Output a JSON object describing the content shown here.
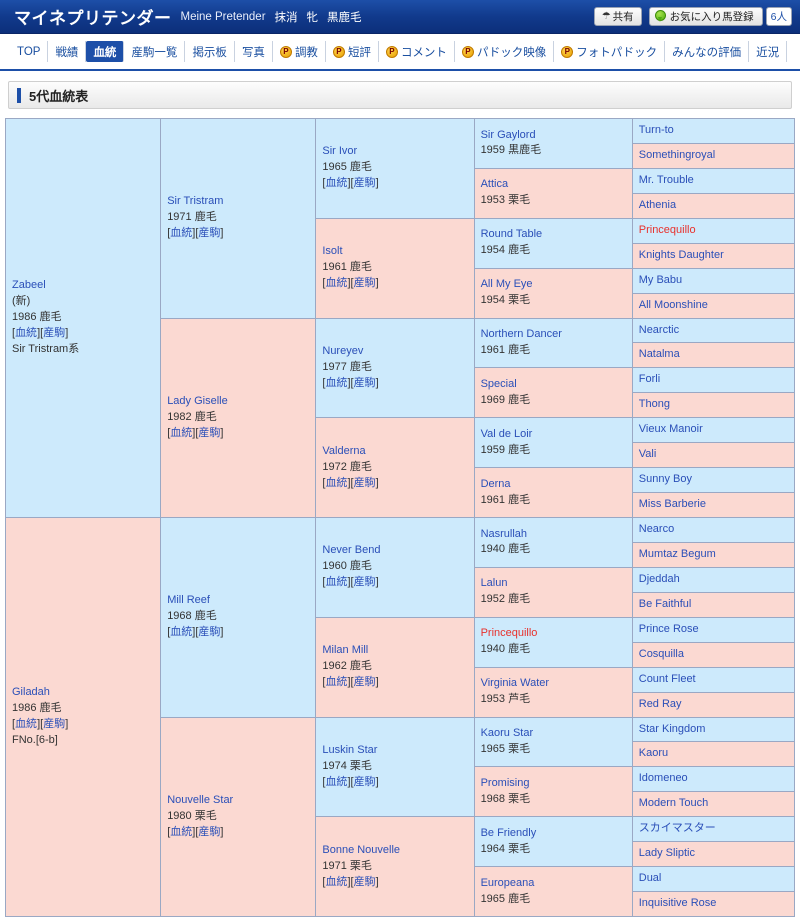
{
  "header": {
    "horse_name_ja": "マイネプリテンダー",
    "horse_name_en": "Meine Pretender",
    "status": "抹消",
    "sex": "牝",
    "color": "黒鹿毛",
    "share_label": "共有",
    "share_icon": "share-icon",
    "favorite_label": "お気に入り馬登録",
    "favorite_icon": "map-pin-icon",
    "favorite_count": "6人",
    "accent_color": "#1d4fa8"
  },
  "nav": {
    "items": [
      {
        "label": "TOP",
        "premium": false,
        "active": false
      },
      {
        "label": "戦績",
        "premium": false,
        "active": false
      },
      {
        "label": "血統",
        "premium": false,
        "active": true
      },
      {
        "label": "産駒一覧",
        "premium": false,
        "active": false
      },
      {
        "label": "掲示板",
        "premium": false,
        "active": false
      },
      {
        "label": "写真",
        "premium": false,
        "active": false
      },
      {
        "label": "調教",
        "premium": true,
        "active": false
      },
      {
        "label": "短評",
        "premium": true,
        "active": false
      },
      {
        "label": "コメント",
        "premium": true,
        "active": false
      },
      {
        "label": "パドック映像",
        "premium": true,
        "active": false
      },
      {
        "label": "フォトパドック",
        "premium": true,
        "active": false
      },
      {
        "label": "みんなの評価",
        "premium": false,
        "active": false
      },
      {
        "label": "近況",
        "premium": false,
        "active": false
      }
    ],
    "premium_badge": "P"
  },
  "section": {
    "title": "5代血統表"
  },
  "links": {
    "pedigree": "血統",
    "offspring": "産駒",
    "open": "[",
    "close": "]"
  },
  "pedigree": {
    "gen1": [
      {
        "name": "Zabeel",
        "country": "(新)",
        "detail": "1986 鹿毛",
        "line": "Sir Tristram系",
        "sex": "m",
        "links": true,
        "red": false
      },
      {
        "name": "Giladah",
        "country": "",
        "detail": "1986 鹿毛",
        "line": "FNo.[6-b]",
        "sex": "f",
        "links": true,
        "red": false
      }
    ],
    "gen2": [
      {
        "name": "Sir Tristram",
        "detail": "1971 鹿毛",
        "sex": "m",
        "links": true,
        "red": false
      },
      {
        "name": "Lady Giselle",
        "detail": "1982 鹿毛",
        "sex": "f",
        "links": true,
        "red": false
      },
      {
        "name": "Mill Reef",
        "detail": "1968 鹿毛",
        "sex": "m",
        "links": true,
        "red": false
      },
      {
        "name": "Nouvelle Star",
        "detail": "1980 栗毛",
        "sex": "f",
        "links": true,
        "red": false
      }
    ],
    "gen3": [
      {
        "name": "Sir Ivor",
        "detail": "1965 鹿毛",
        "sex": "m",
        "links": true,
        "red": false
      },
      {
        "name": "Isolt",
        "detail": "1961 鹿毛",
        "sex": "f",
        "links": true,
        "red": false
      },
      {
        "name": "Nureyev",
        "detail": "1977 鹿毛",
        "sex": "m",
        "links": true,
        "red": false
      },
      {
        "name": "Valderna",
        "detail": "1972 鹿毛",
        "sex": "f",
        "links": true,
        "red": false
      },
      {
        "name": "Never Bend",
        "detail": "1960 鹿毛",
        "sex": "m",
        "links": true,
        "red": false
      },
      {
        "name": "Milan Mill",
        "detail": "1962 鹿毛",
        "sex": "f",
        "links": true,
        "red": false
      },
      {
        "name": "Luskin Star",
        "detail": "1974 栗毛",
        "sex": "m",
        "links": true,
        "red": false
      },
      {
        "name": "Bonne Nouvelle",
        "detail": "1971 栗毛",
        "sex": "f",
        "links": true,
        "red": false
      }
    ],
    "gen4": [
      {
        "name": "Sir Gaylord",
        "detail": "1959 黒鹿毛",
        "sex": "m",
        "red": false
      },
      {
        "name": "Attica",
        "detail": "1953 栗毛",
        "sex": "f",
        "red": false
      },
      {
        "name": "Round Table",
        "detail": "1954 鹿毛",
        "sex": "m",
        "red": false
      },
      {
        "name": "All My Eye",
        "detail": "1954 栗毛",
        "sex": "f",
        "red": false
      },
      {
        "name": "Northern Dancer",
        "detail": "1961 鹿毛",
        "sex": "m",
        "red": false
      },
      {
        "name": "Special",
        "detail": "1969 鹿毛",
        "sex": "f",
        "red": false
      },
      {
        "name": "Val de Loir",
        "detail": "1959 鹿毛",
        "sex": "m",
        "red": false
      },
      {
        "name": "Derna",
        "detail": "1961 鹿毛",
        "sex": "f",
        "red": false
      },
      {
        "name": "Nasrullah",
        "detail": "1940 鹿毛",
        "sex": "m",
        "red": false
      },
      {
        "name": "Lalun",
        "detail": "1952 鹿毛",
        "sex": "f",
        "red": false
      },
      {
        "name": "Princequillo",
        "detail": "1940 鹿毛",
        "sex": "m",
        "red": true
      },
      {
        "name": "Virginia Water",
        "detail": "1953 芦毛",
        "sex": "f",
        "red": false
      },
      {
        "name": "Kaoru Star",
        "detail": "1965 栗毛",
        "sex": "m",
        "red": false
      },
      {
        "name": "Promising",
        "detail": "1968 栗毛",
        "sex": "f",
        "red": false
      },
      {
        "name": "Be Friendly",
        "detail": "1964 栗毛",
        "sex": "m",
        "red": false
      },
      {
        "name": "Europeana",
        "detail": "1965 鹿毛",
        "sex": "f",
        "red": false
      }
    ],
    "gen5": [
      {
        "name": "Turn-to",
        "sex": "m",
        "red": false
      },
      {
        "name": "Somethingroyal",
        "sex": "f",
        "red": false
      },
      {
        "name": "Mr. Trouble",
        "sex": "m",
        "red": false
      },
      {
        "name": "Athenia",
        "sex": "f",
        "red": false
      },
      {
        "name": "Princequillo",
        "sex": "m",
        "red": true
      },
      {
        "name": "Knights Daughter",
        "sex": "f",
        "red": false
      },
      {
        "name": "My Babu",
        "sex": "m",
        "red": false
      },
      {
        "name": "All Moonshine",
        "sex": "f",
        "red": false
      },
      {
        "name": "Nearctic",
        "sex": "m",
        "red": false
      },
      {
        "name": "Natalma",
        "sex": "f",
        "red": false
      },
      {
        "name": "Forli",
        "sex": "m",
        "red": false
      },
      {
        "name": "Thong",
        "sex": "f",
        "red": false
      },
      {
        "name": "Vieux Manoir",
        "sex": "m",
        "red": false
      },
      {
        "name": "Vali",
        "sex": "f",
        "red": false
      },
      {
        "name": "Sunny Boy",
        "sex": "m",
        "red": false
      },
      {
        "name": "Miss Barberie",
        "sex": "f",
        "red": false
      },
      {
        "name": "Nearco",
        "sex": "m",
        "red": false
      },
      {
        "name": "Mumtaz Begum",
        "sex": "f",
        "red": false
      },
      {
        "name": "Djeddah",
        "sex": "m",
        "red": false
      },
      {
        "name": "Be Faithful",
        "sex": "f",
        "red": false
      },
      {
        "name": "Prince Rose",
        "sex": "m",
        "red": false
      },
      {
        "name": "Cosquilla",
        "sex": "f",
        "red": false
      },
      {
        "name": "Count Fleet",
        "sex": "m",
        "red": false
      },
      {
        "name": "Red Ray",
        "sex": "f",
        "red": false
      },
      {
        "name": "Star Kingdom",
        "sex": "m",
        "red": false
      },
      {
        "name": "Kaoru",
        "sex": "f",
        "red": false
      },
      {
        "name": "Idomeneo",
        "sex": "m",
        "red": false
      },
      {
        "name": "Modern Touch",
        "sex": "f",
        "red": false
      },
      {
        "name": "スカイマスター",
        "sex": "m",
        "red": false
      },
      {
        "name": "Lady Sliptic",
        "sex": "f",
        "red": false
      },
      {
        "name": "Dual",
        "sex": "m",
        "red": false
      },
      {
        "name": "Inquisitive Rose",
        "sex": "f",
        "red": false
      }
    ]
  }
}
